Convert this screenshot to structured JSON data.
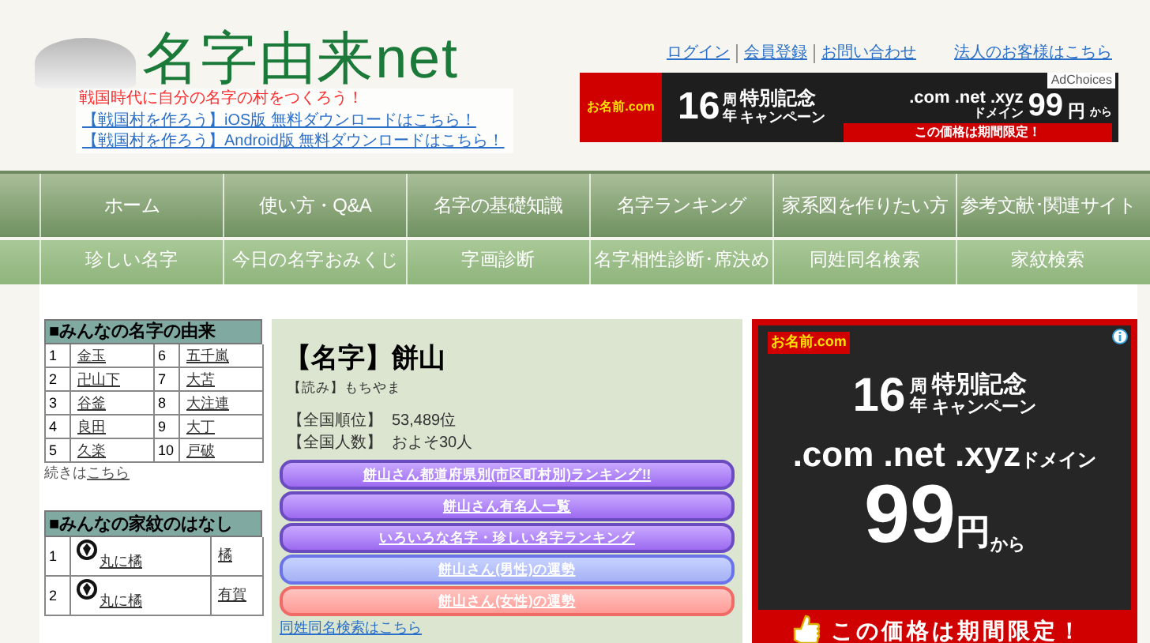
{
  "header": {
    "logo": "名字由来net",
    "promo": "戦国時代に自分の名字の村をつくろう！",
    "app_links": [
      "【戦国村を作ろう】iOS版 無料ダウンロードはこちら！",
      "【戦国村を作ろう】Android版 無料ダウンロードはこちら！"
    ],
    "top_links": [
      "ログイン",
      "会員登録",
      "お問い合わせ",
      "法人のお客様はこちら"
    ]
  },
  "banner_ad": {
    "logo": "お名前.com",
    "years": "16",
    "years_unit_1": "周",
    "years_unit_2": "年",
    "headline": "特別記念",
    "campaign": "キャンペーン",
    "domains": ".com .net .xyz",
    "domain_word": "ドメイン",
    "price": "99",
    "currency": "円",
    "from": "から",
    "footer": "この価格は期間限定！",
    "adchoices": "AdChoices"
  },
  "nav_primary": [
    "ホーム",
    "使い方・Q&A",
    "名字の基礎知識",
    "名字ランキング",
    "家系図を作りたい方",
    "参考文献･関連サイト"
  ],
  "nav_secondary": [
    "珍しい名字",
    "今日の名字おみくじ",
    "字画診断",
    "名字相性診断･席決め",
    "同姓同名検索",
    "家紋検索"
  ],
  "origins": {
    "title": "■みんなの名字の由来",
    "rows": [
      {
        "rank": "1",
        "name": "金玉"
      },
      {
        "rank": "2",
        "name": "卍山下"
      },
      {
        "rank": "3",
        "name": "谷釜"
      },
      {
        "rank": "4",
        "name": "良田"
      },
      {
        "rank": "5",
        "name": "久楽"
      },
      {
        "rank": "6",
        "name": "五千嵐"
      },
      {
        "rank": "7",
        "name": "大苫"
      },
      {
        "rank": "8",
        "name": "大注連"
      },
      {
        "rank": "9",
        "name": "大丁"
      },
      {
        "rank": "10",
        "name": "戸破"
      }
    ],
    "more_prefix": "続きは",
    "more_link": "こちら"
  },
  "kamon": {
    "title": "■みんなの家紋のはなし",
    "rows": [
      {
        "rank": "1",
        "name": "丸に橘",
        "column_3": "橘"
      },
      {
        "rank": "2",
        "name": "丸に橘",
        "column_3": "有賀"
      }
    ]
  },
  "main": {
    "title": "【名字】餅山",
    "reading_label": "【読み】",
    "reading": "もちやま",
    "stats": [
      {
        "label": "【全国順位】",
        "value": "53,489位"
      },
      {
        "label": "【全国人数】",
        "value": "およそ30人"
      }
    ],
    "buttons": [
      {
        "label": "餅山さん都道府県別(市区町村別)ランキング!!",
        "kind": "purple"
      },
      {
        "label": "餅山さん有名人一覧",
        "kind": "purple"
      },
      {
        "label": "いろいろな名字・珍しい名字ランキング",
        "kind": "purple"
      },
      {
        "label": "餅山さん(男性)の運勢",
        "kind": "blue"
      },
      {
        "label": "餅山さん(女性)の運勢",
        "kind": "pink"
      }
    ],
    "footer_link": "同姓同名検索はこちら"
  },
  "side_ad": {
    "logo": "お名前.com",
    "years": "16",
    "years_unit_1": "周",
    "years_unit_2": "年",
    "headline": "特別記念",
    "campaign": "キャンペーン",
    "domains": ".com .net .xyz",
    "domain_word": "ドメイン",
    "price": "99",
    "currency": "円",
    "from": "から",
    "footer": "この価格は期間限定！"
  }
}
